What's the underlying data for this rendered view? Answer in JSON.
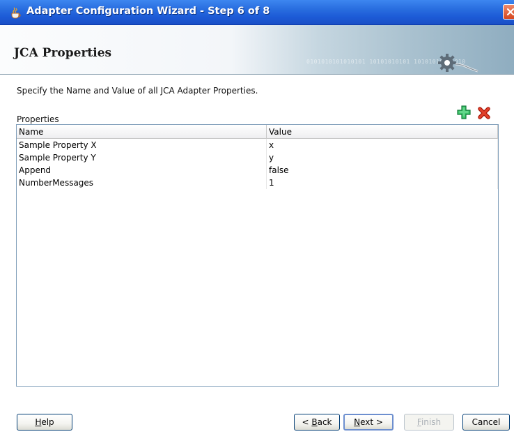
{
  "window": {
    "title": "Adapter Configuration Wizard - Step 6 of 8",
    "app_icon": "java-cup-icon",
    "close_icon": "close-icon"
  },
  "header": {
    "title": "JCA Properties",
    "decoration_text": "0101010101010101  10101010101 10101010101010"
  },
  "instruction": "Specify the Name and Value of all JCA Adapter Properties.",
  "properties": {
    "label": "Properties",
    "add_icon": "add-icon",
    "delete_icon": "delete-icon",
    "columns": [
      "Name",
      "Value"
    ],
    "rows": [
      {
        "name": "Sample Property X",
        "value": "x"
      },
      {
        "name": "Sample Property Y",
        "value": "y"
      },
      {
        "name": "Append",
        "value": "false"
      },
      {
        "name": "NumberMessages",
        "value": "1"
      }
    ]
  },
  "buttons": {
    "help": {
      "pre": "",
      "mnemonic": "H",
      "post": "elp"
    },
    "back": {
      "pre": "< ",
      "mnemonic": "B",
      "post": "ack"
    },
    "next": {
      "pre": "",
      "mnemonic": "N",
      "post": "ext >"
    },
    "finish": {
      "pre": "",
      "mnemonic": "F",
      "post": "inish"
    },
    "cancel": {
      "pre": "",
      "mnemonic": "",
      "post": "Cancel"
    }
  },
  "colors": {
    "titlebar": "#2a6fe0",
    "add_icon": "#1ea84a",
    "delete_icon": "#d42a1a"
  }
}
